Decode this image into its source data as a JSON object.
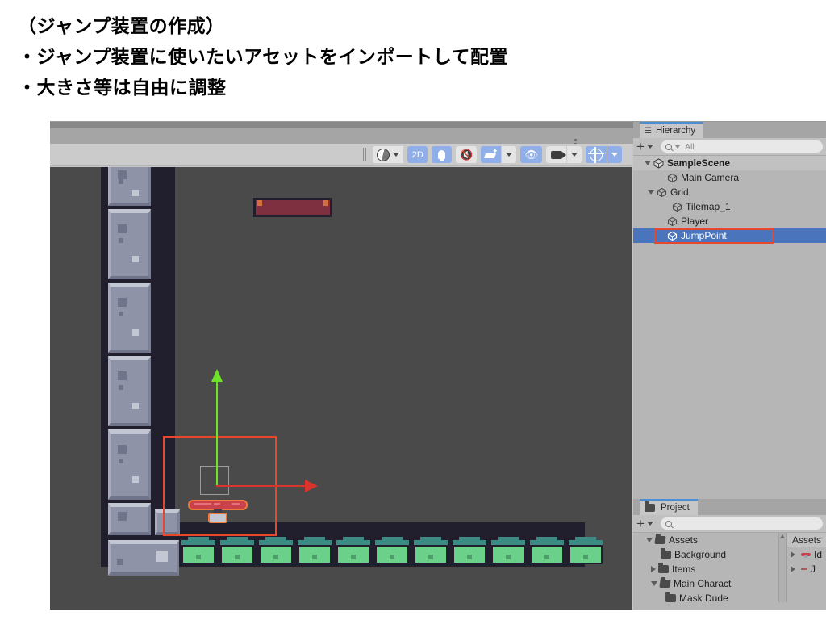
{
  "slide": {
    "lines": [
      "（ジャンプ装置の作成）",
      "・ジャンプ装置に使いたいアセットをインポートして配置",
      "・大きさ等は自由に調整"
    ]
  },
  "scene_toolbar": {
    "shading_label": "",
    "mode_2d": "2D",
    "light_toggle": "light-toggle",
    "audio_mute": "audio-mute",
    "effects": "effects",
    "hidden_objects": "hidden-objects",
    "camera": "camera",
    "gizmos": "gizmos"
  },
  "hierarchy": {
    "tab_label": "Hierarchy",
    "add_label": "+",
    "search_placeholder": "All",
    "search_value": "All",
    "items": [
      {
        "label": "SampleScene",
        "depth": 0,
        "icon": "unity-scene-icon",
        "twisty": "down",
        "selected": false,
        "root": true
      },
      {
        "label": "Main Camera",
        "depth": 1,
        "icon": "gameobject-icon",
        "twisty": "none",
        "selected": false,
        "root": false
      },
      {
        "label": "Grid",
        "depth": 1,
        "icon": "gameobject-icon",
        "twisty": "down",
        "selected": false,
        "root": false
      },
      {
        "label": "Tilemap_1",
        "depth": 2,
        "icon": "gameobject-icon",
        "twisty": "none",
        "selected": false,
        "root": false
      },
      {
        "label": "Player",
        "depth": 1,
        "icon": "gameobject-icon",
        "twisty": "none",
        "selected": false,
        "root": false
      },
      {
        "label": "JumpPoint",
        "depth": 1,
        "icon": "gameobject-icon",
        "twisty": "none",
        "selected": true,
        "root": false
      }
    ]
  },
  "project": {
    "tab_label": "Project",
    "add_label": "+",
    "search_placeholder": "",
    "search_value": "",
    "tree": [
      {
        "label": "Assets",
        "depth": 0,
        "twisty": "down",
        "folder": "open"
      },
      {
        "label": "Background",
        "depth": 1,
        "twisty": "none",
        "folder": "closed"
      },
      {
        "label": "Items",
        "depth": 1,
        "twisty": "right",
        "folder": "closed"
      },
      {
        "label": "Main Charact",
        "depth": 1,
        "twisty": "down",
        "folder": "open"
      },
      {
        "label": "Mask Dude",
        "depth": 2,
        "twisty": "none",
        "folder": "closed"
      }
    ],
    "content_header": "Assets",
    "content_items": [
      {
        "label": "Id",
        "icon": "trampoline-icon",
        "twisty": "right"
      },
      {
        "label": "J",
        "icon": "dash-icon",
        "twisty": "right"
      }
    ]
  },
  "colors": {
    "selection_blue": "#4a75bd",
    "selection_outline_red": "#e8472b",
    "gizmo_green": "#6fe22a",
    "gizmo_red": "#d8342a",
    "scene_background": "#4a4a4a",
    "tile_dark": "#211f2e",
    "grass_green": "#6bd08a",
    "toolbar_active_blue": "#90aee8"
  }
}
